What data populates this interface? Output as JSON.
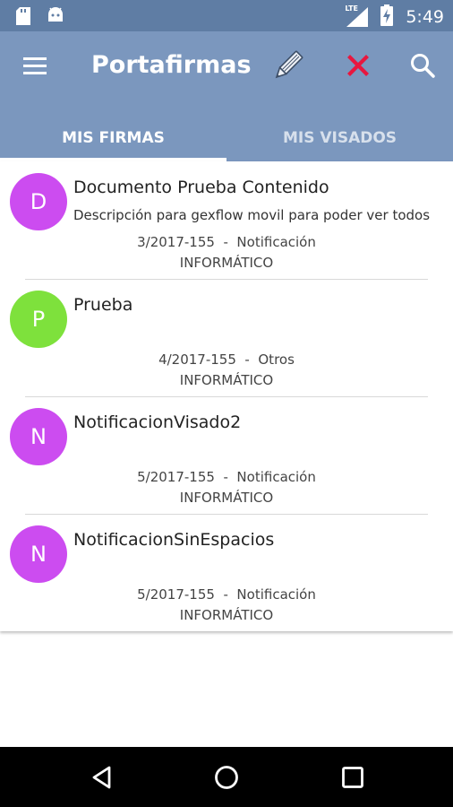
{
  "status_bar": {
    "time": "5:49",
    "network": "LTE",
    "icons": [
      "sd-card-icon",
      "android-icon",
      "signal-icon",
      "battery-charging-icon"
    ]
  },
  "app_bar": {
    "title": "Portafirmas",
    "actions": [
      "menu-icon",
      "pencil-icon",
      "close-icon",
      "search-icon"
    ],
    "colors": {
      "status_bar": "#5f7da4",
      "app_bar": "#7b97be",
      "close_red": "#e8173f"
    }
  },
  "tabs": [
    {
      "label": "MIS FIRMAS",
      "active": true
    },
    {
      "label": "MIS VISADOS",
      "active": false
    }
  ],
  "documents": [
    {
      "initial": "D",
      "avatar_color": "#cc4cf0",
      "title": "Documento Prueba Contenido",
      "description": "Descripción para gexflow movil para poder ver todos",
      "meta": "3/2017-155  -  Notificación",
      "department": "INFORMÁTICO"
    },
    {
      "initial": "P",
      "avatar_color": "#7ee13c",
      "title": "Prueba",
      "description": "",
      "meta": "4/2017-155  -  Otros",
      "department": "INFORMÁTICO"
    },
    {
      "initial": "N",
      "avatar_color": "#cc4cf0",
      "title": "NotificacionVisado2",
      "description": "",
      "meta": "5/2017-155  -  Notificación",
      "department": "INFORMÁTICO"
    },
    {
      "initial": "N",
      "avatar_color": "#cc4cf0",
      "title": "NotificacionSinEspacios",
      "description": "",
      "meta": "5/2017-155  -  Notificación",
      "department": "INFORMÁTICO"
    }
  ],
  "nav_bar": {
    "buttons": [
      "back-icon",
      "home-icon",
      "recents-icon"
    ]
  }
}
